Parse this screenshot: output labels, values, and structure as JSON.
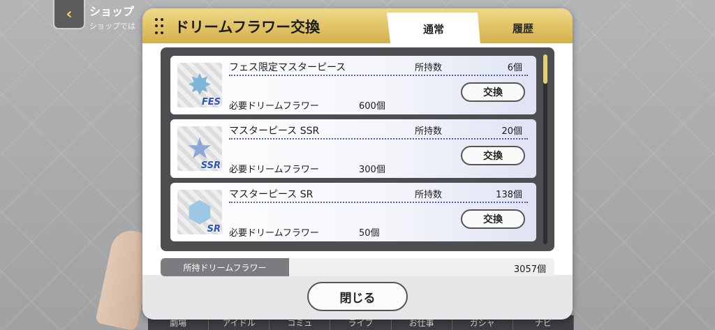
{
  "background": {
    "shop": {
      "title": "ショップ",
      "subtitle": "ショップでは"
    },
    "bottom_nav": [
      "劇場",
      "アイドル",
      "コミュ",
      "ライブ",
      "お仕事",
      "ガシャ",
      "ナビ"
    ]
  },
  "modal": {
    "title": "ドリームフラワー交換",
    "tabs": {
      "normal": "通常",
      "history": "履歴"
    },
    "items": [
      {
        "name": "フェス限定マスターピース",
        "owned_label": "所持数",
        "owned": "6個",
        "required_label": "必要ドリームフラワー",
        "required": "600個",
        "button": "交換",
        "badge": "FES",
        "icon": "rainbow-star-gem-icon"
      },
      {
        "name": "マスターピース SSR",
        "owned_label": "所持数",
        "owned": "20個",
        "required_label": "必要ドリームフラワー",
        "required": "300個",
        "button": "交換",
        "badge": "SSR",
        "icon": "blue-star-gem-icon"
      },
      {
        "name": "マスターピース SR",
        "owned_label": "所持数",
        "owned": "138個",
        "required_label": "必要ドリームフラワー",
        "required": "50個",
        "button": "交換",
        "badge": "SR",
        "icon": "crystal-gem-icon"
      }
    ],
    "total": {
      "label": "所持ドリームフラワー",
      "value": "3057個"
    },
    "close_button": "閉じる"
  },
  "colors": {
    "header_gold": "#d4b04a",
    "list_frame": "#4d4e52",
    "scroll_thumb": "#e8cf72",
    "accent_blue": "#2d54b8"
  }
}
